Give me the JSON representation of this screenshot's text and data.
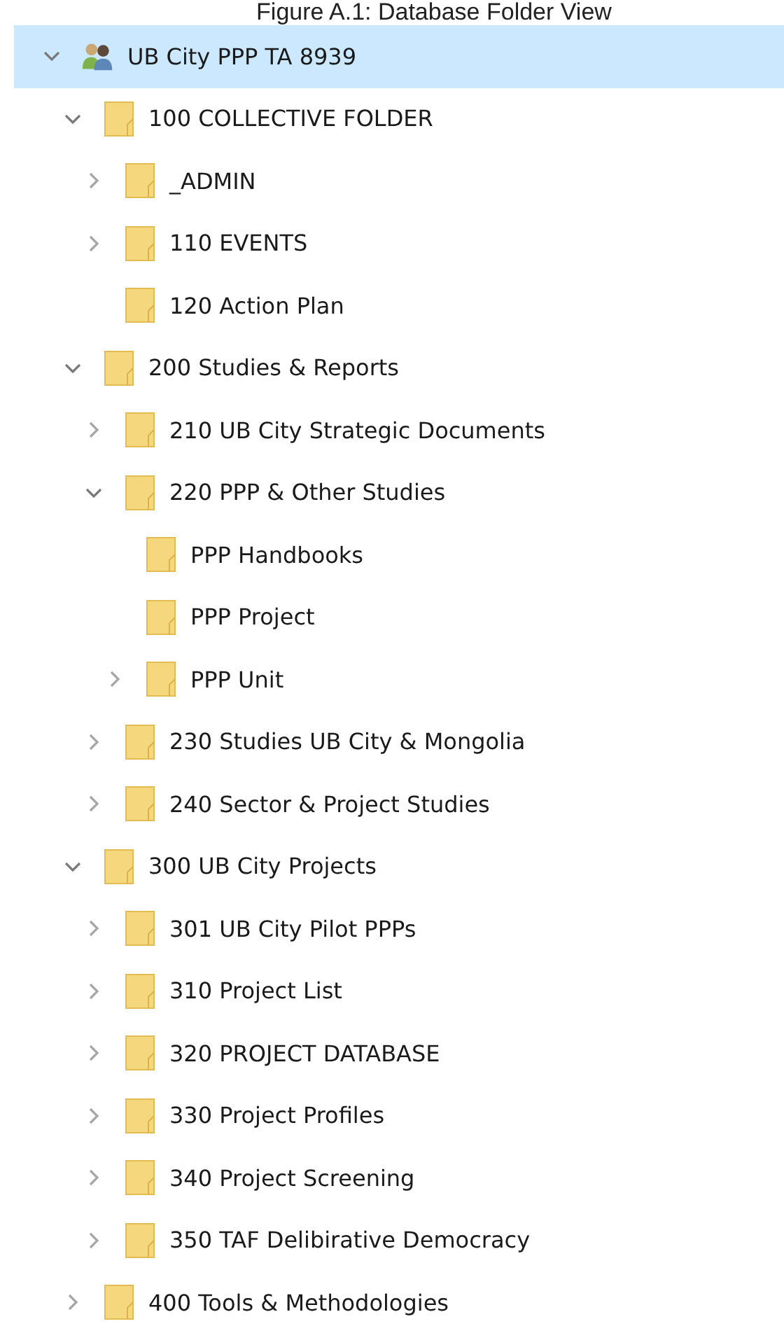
{
  "caption": "Figure A.1: Database Folder View",
  "tree": [
    {
      "label": "UB City PPP TA 8939",
      "kind": "group",
      "expandable": true,
      "expanded": true,
      "selected": true,
      "children": [
        {
          "label": "100 COLLECTIVE FOLDER",
          "kind": "folder",
          "expandable": true,
          "expanded": true,
          "selected": false,
          "children": [
            {
              "label": "_ADMIN",
              "kind": "folder",
              "expandable": true,
              "expanded": false,
              "selected": false
            },
            {
              "label": "110 EVENTS",
              "kind": "folder",
              "expandable": true,
              "expanded": false,
              "selected": false
            },
            {
              "label": "120 Action Plan",
              "kind": "folder",
              "expandable": false,
              "selected": false
            }
          ]
        },
        {
          "label": "200 Studies & Reports",
          "kind": "folder",
          "expandable": true,
          "expanded": true,
          "selected": false,
          "children": [
            {
              "label": "210 UB City Strategic Documents",
              "kind": "folder",
              "expandable": true,
              "expanded": false,
              "selected": false
            },
            {
              "label": "220 PPP & Other Studies",
              "kind": "folder",
              "expandable": true,
              "expanded": true,
              "selected": false,
              "children": [
                {
                  "label": "PPP Handbooks",
                  "kind": "folder",
                  "expandable": false,
                  "selected": false
                },
                {
                  "label": "PPP Project",
                  "kind": "folder",
                  "expandable": false,
                  "selected": false
                },
                {
                  "label": "PPP Unit",
                  "kind": "folder",
                  "expandable": true,
                  "expanded": false,
                  "selected": false
                }
              ]
            },
            {
              "label": "230 Studies UB City & Mongolia",
              "kind": "folder",
              "expandable": true,
              "expanded": false,
              "selected": false
            },
            {
              "label": "240 Sector & Project Studies",
              "kind": "folder",
              "expandable": true,
              "expanded": false,
              "selected": false
            }
          ]
        },
        {
          "label": "300 UB City Projects",
          "kind": "folder",
          "expandable": true,
          "expanded": true,
          "selected": false,
          "children": [
            {
              "label": "301 UB City Pilot PPPs",
              "kind": "folder",
              "expandable": true,
              "expanded": false,
              "selected": false
            },
            {
              "label": "310 Project List",
              "kind": "folder",
              "expandable": true,
              "expanded": false,
              "selected": false
            },
            {
              "label": "320 PROJECT DATABASE",
              "kind": "folder",
              "expandable": true,
              "expanded": false,
              "selected": false
            },
            {
              "label": "330 Project Profiles",
              "kind": "folder",
              "expandable": true,
              "expanded": false,
              "selected": false
            },
            {
              "label": "340 Project Screening",
              "kind": "folder",
              "expandable": true,
              "expanded": false,
              "selected": false
            },
            {
              "label": "350 TAF Delibirative Democracy",
              "kind": "folder",
              "expandable": true,
              "expanded": false,
              "selected": false
            }
          ]
        },
        {
          "label": "400 Tools & Methodologies",
          "kind": "folder",
          "expandable": true,
          "expanded": false,
          "selected": false
        }
      ]
    }
  ]
}
